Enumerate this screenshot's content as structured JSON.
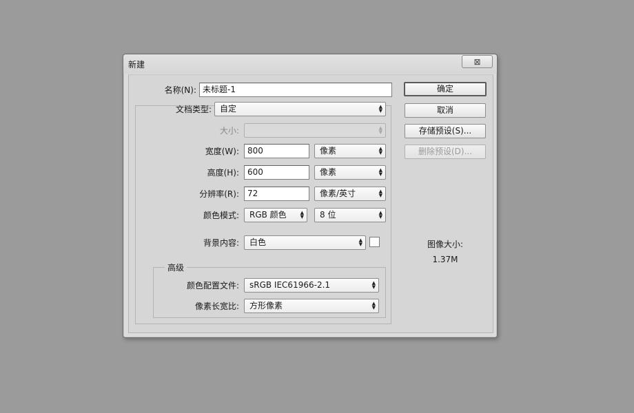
{
  "dialog": {
    "title": "新建",
    "close_glyph": "⊠"
  },
  "fields": {
    "name": {
      "label": "名称(N):",
      "value": "未标题-1"
    },
    "doc_type": {
      "label": "文档类型:",
      "value": "自定"
    },
    "size": {
      "label": "大小:",
      "value": ""
    },
    "width": {
      "label": "宽度(W):",
      "value": "800",
      "unit": "像素"
    },
    "height": {
      "label": "高度(H):",
      "value": "600",
      "unit": "像素"
    },
    "resolution": {
      "label": "分辨率(R):",
      "value": "72",
      "unit": "像素/英寸"
    },
    "color_mode": {
      "label": "颜色模式:",
      "value": "RGB 颜色",
      "depth": "8 位"
    },
    "background": {
      "label": "背景内容:",
      "value": "白色",
      "swatch_color": "#ffffff"
    }
  },
  "advanced": {
    "title": "高级",
    "color_profile": {
      "label": "颜色配置文件:",
      "value": "sRGB IEC61966-2.1"
    },
    "pixel_aspect": {
      "label": "像素长宽比:",
      "value": "方形像素"
    }
  },
  "buttons": {
    "ok": "确定",
    "cancel": "取消",
    "save_preset": "存储预设(S)...",
    "delete_preset": "删除预设(D)..."
  },
  "image_size": {
    "label": "图像大小:",
    "value": "1.37M"
  }
}
